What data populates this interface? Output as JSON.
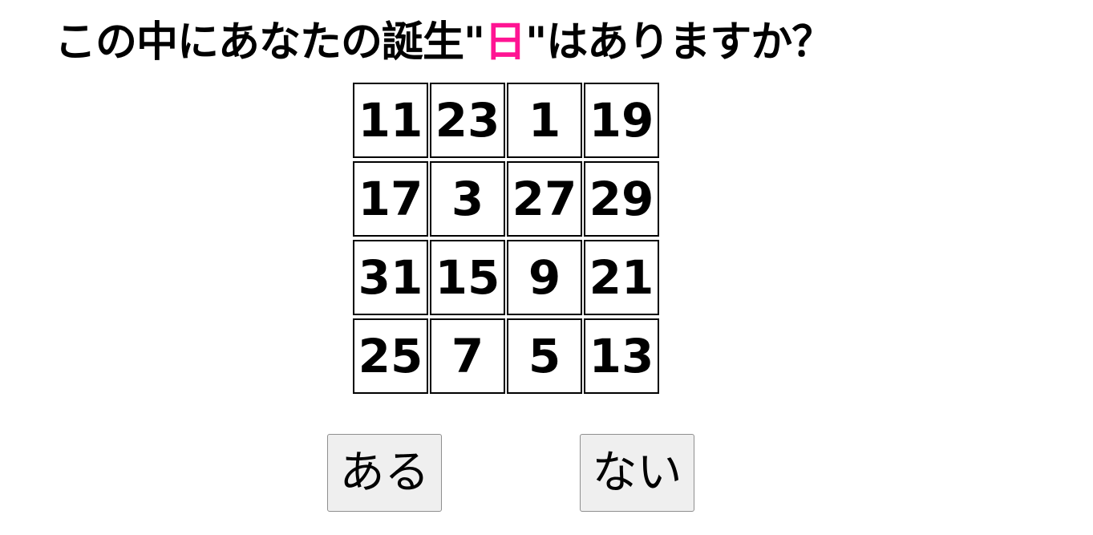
{
  "question": {
    "prefix": "この中にあなたの誕生\"",
    "highlight": "日",
    "suffix": "\"はありますか？",
    "highlight_color": "#ff1493"
  },
  "grid": {
    "rows": [
      [
        "11",
        "23",
        "1",
        "19"
      ],
      [
        "17",
        "3",
        "27",
        "29"
      ],
      [
        "31",
        "15",
        "9",
        "21"
      ],
      [
        "25",
        "7",
        "5",
        "13"
      ]
    ]
  },
  "buttons": {
    "yes_label": "ある",
    "no_label": "ない"
  }
}
